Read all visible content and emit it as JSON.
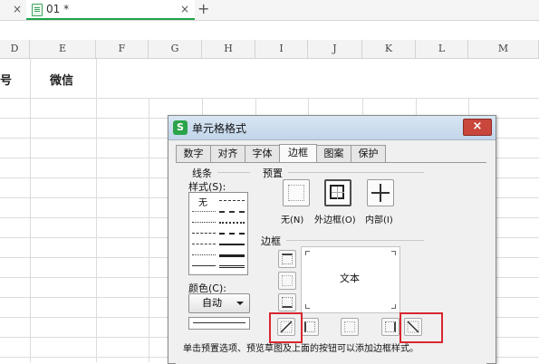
{
  "tabbar": {
    "prev_close": "×",
    "tab_title": "01 *",
    "tab_close": "×",
    "new_tab": "+"
  },
  "sheet": {
    "columns": [
      "D",
      "E",
      "F",
      "G",
      "H",
      "I",
      "J",
      "K",
      "L",
      "M"
    ],
    "cell_d2": "号",
    "cell_e2": "微信"
  },
  "dialog": {
    "app_icon": "S",
    "title": "单元格格式",
    "close": "×",
    "tabs": [
      "数字",
      "对齐",
      "字体",
      "边框",
      "图案",
      "保护"
    ],
    "active_tab": "边框",
    "line_group": "线条",
    "style_label": "样式(S):",
    "style_none": "无",
    "color_label": "颜色(C):",
    "color_value": "自动",
    "preset_group": "预置",
    "presets": [
      "无(N)",
      "外边框(O)",
      "内部(I)"
    ],
    "border_group": "边框",
    "preview_text": "文本",
    "hint": "单击预置选项、预览草图及上面的按钮可以添加边框样式。"
  },
  "colors": {
    "accent_green": "#1fa34a",
    "close_red": "#c9463d",
    "highlight_red": "#d8272f"
  }
}
